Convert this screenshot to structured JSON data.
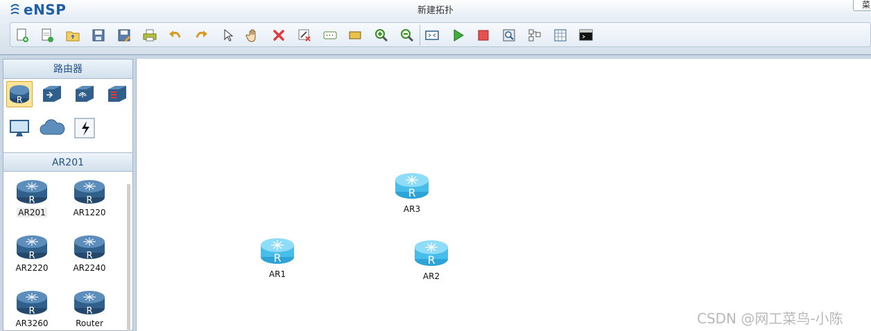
{
  "app": {
    "name": "eNSP",
    "window_title": "新建拓扑",
    "menu_button_label": "菜"
  },
  "toolbar": {
    "buttons": [
      {
        "name": "new-topology",
        "icon": "new-file-icon"
      },
      {
        "name": "new-lab",
        "icon": "new-lab-icon"
      },
      {
        "name": "open",
        "icon": "open-folder-icon"
      },
      {
        "name": "save",
        "icon": "save-icon"
      },
      {
        "name": "save-as",
        "icon": "save-as-icon"
      },
      {
        "name": "print",
        "icon": "print-icon"
      },
      {
        "name": "undo",
        "icon": "undo-icon"
      },
      {
        "name": "redo",
        "icon": "redo-icon"
      },
      {
        "name": "select",
        "icon": "cursor-icon"
      },
      {
        "name": "pan",
        "icon": "hand-icon"
      },
      {
        "name": "delete",
        "icon": "delete-icon"
      },
      {
        "name": "delete-all-links",
        "icon": "delete-links-icon"
      },
      {
        "name": "text-annotation",
        "icon": "text-box-icon"
      },
      {
        "name": "rectangle",
        "icon": "rectangle-icon"
      },
      {
        "name": "zoom-in",
        "icon": "zoom-in-icon"
      },
      {
        "name": "zoom-out",
        "icon": "zoom-out-icon"
      },
      {
        "name": "fit-view",
        "icon": "fit-view-icon"
      },
      {
        "name": "start-devices",
        "icon": "play-icon"
      },
      {
        "name": "stop-devices",
        "icon": "stop-icon"
      },
      {
        "name": "capture",
        "icon": "capture-icon"
      },
      {
        "name": "topology",
        "icon": "topology-icon"
      },
      {
        "name": "grid",
        "icon": "grid-icon"
      },
      {
        "name": "console",
        "icon": "terminal-icon"
      }
    ]
  },
  "left_panel": {
    "category_title": "路由器",
    "categories": [
      {
        "name": "router",
        "icon": "router-icon",
        "selected": true
      },
      {
        "name": "switch",
        "icon": "switch-icon",
        "selected": false
      },
      {
        "name": "wireless",
        "icon": "wireless-icon",
        "selected": false
      },
      {
        "name": "firewall",
        "icon": "firewall-icon",
        "selected": false
      },
      {
        "name": "terminal",
        "icon": "pc-icon",
        "selected": false
      },
      {
        "name": "cloud",
        "icon": "cloud-icon",
        "selected": false
      },
      {
        "name": "cable",
        "icon": "cable-icon",
        "selected": false
      }
    ],
    "models_title": "AR201",
    "models": [
      {
        "label": "AR201",
        "selected": true
      },
      {
        "label": "AR1220",
        "selected": false
      },
      {
        "label": "AR2220",
        "selected": false
      },
      {
        "label": "AR2240",
        "selected": false
      },
      {
        "label": "AR3260",
        "selected": false
      },
      {
        "label": "Router",
        "selected": false
      }
    ]
  },
  "canvas": {
    "nodes": [
      {
        "label": "AR3",
        "type": "router"
      },
      {
        "label": "AR1",
        "type": "router"
      },
      {
        "label": "AR2",
        "type": "router"
      }
    ],
    "watermark": "CSDN @网工菜鸟-小陈"
  },
  "colors": {
    "router_dark": "#2f5f8a",
    "router_light": "#4fc3f0",
    "brand": "#1d5fa8"
  }
}
